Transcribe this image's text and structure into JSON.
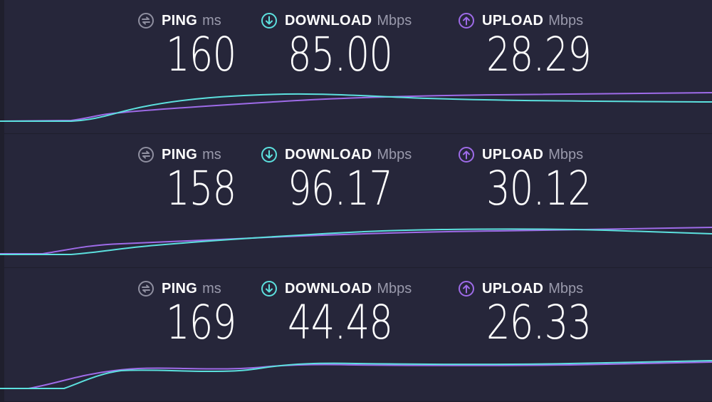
{
  "colors": {
    "background": "#1f1f2d",
    "panel": "#26263a",
    "download_accent": "#5ce0de",
    "upload_accent": "#9e6be8",
    "ping_icon": "#8f8fa0"
  },
  "icons": {
    "ping": "ping-arrows-icon",
    "download": "download-arrow-icon",
    "upload": "upload-arrow-icon"
  },
  "labels": {
    "ping": "PING",
    "ping_unit": "ms",
    "download": "DOWNLOAD",
    "download_unit": "Mbps",
    "upload": "UPLOAD",
    "upload_unit": "Mbps"
  },
  "results": [
    {
      "ping": "160",
      "download": "85.00",
      "upload": "28.29"
    },
    {
      "ping": "158",
      "download": "96.17",
      "upload": "30.12"
    },
    {
      "ping": "169",
      "download": "44.48",
      "upload": "26.33"
    }
  ]
}
